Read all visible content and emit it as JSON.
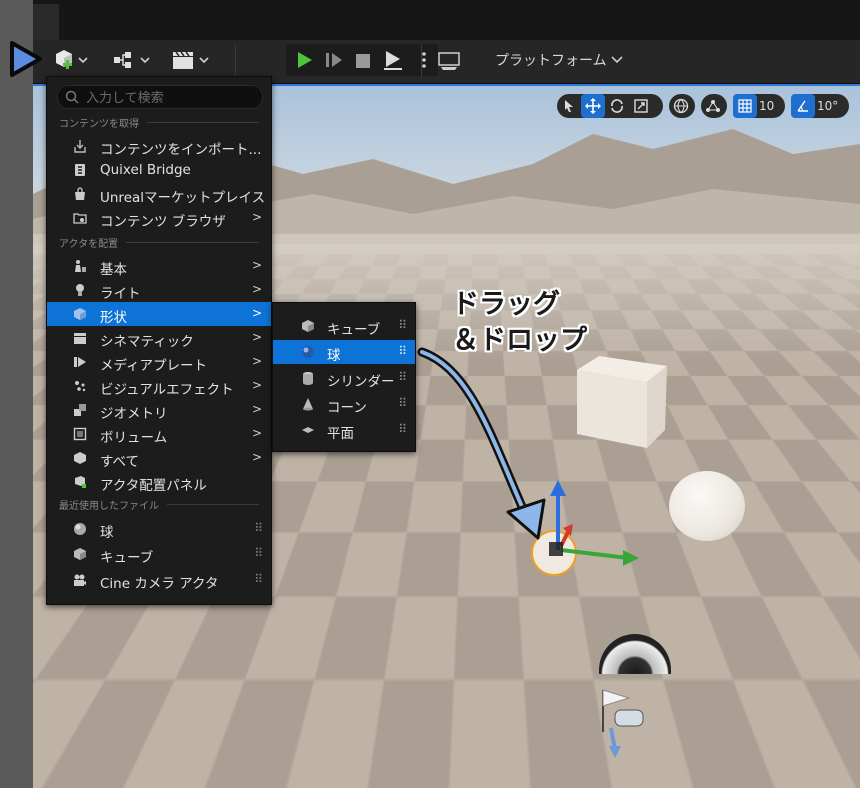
{
  "toolbar": {
    "platform_label": "プラットフォーム"
  },
  "viewport_toolbar": {
    "grid_snap": "10",
    "rotate_snap": "10°"
  },
  "menu": {
    "search_placeholder": "入力して検索",
    "sections": {
      "get_content": "コンテンツを取得",
      "place_actors": "アクタを配置",
      "recent": "最近使用したファイル"
    },
    "get_content_items": [
      {
        "label": "コンテンツをインポート...",
        "icon": "import-icon"
      },
      {
        "label": "Quixel Bridge",
        "icon": "bridge-icon"
      },
      {
        "label": "Unrealマーケットプレイス",
        "icon": "marketplace-icon"
      },
      {
        "label": "コンテンツ ブラウザ",
        "icon": "content-browser-icon"
      }
    ],
    "place_items": [
      {
        "label": "基本",
        "icon": "basic-icon"
      },
      {
        "label": "ライト",
        "icon": "light-icon"
      },
      {
        "label": "形状",
        "icon": "shape-icon",
        "selected": true
      },
      {
        "label": "シネマティック",
        "icon": "cinematic-icon"
      },
      {
        "label": "メディアプレート",
        "icon": "media-icon"
      },
      {
        "label": "ビジュアルエフェクト",
        "icon": "vfx-icon"
      },
      {
        "label": "ジオメトリ",
        "icon": "geometry-icon"
      },
      {
        "label": "ボリューム",
        "icon": "volume-icon"
      },
      {
        "label": "すべて",
        "icon": "all-icon"
      },
      {
        "label": "アクタ配置パネル",
        "icon": "place-panel-icon"
      }
    ],
    "recent_items": [
      {
        "label": "球",
        "icon": "sphere-icon"
      },
      {
        "label": "キューブ",
        "icon": "cube-icon"
      },
      {
        "label": "Cine カメラ アクタ",
        "icon": "camera-icon"
      }
    ]
  },
  "submenu": {
    "items": [
      {
        "label": "キューブ",
        "icon": "cube-icon"
      },
      {
        "label": "球",
        "icon": "sphere-icon",
        "selected": true
      },
      {
        "label": "シリンダー",
        "icon": "cylinder-icon"
      },
      {
        "label": "コーン",
        "icon": "cone-icon"
      },
      {
        "label": "平面",
        "icon": "plane-icon"
      }
    ]
  },
  "annotation": {
    "line1": "ドラッグ",
    "line2": "＆ドロップ"
  },
  "colors": {
    "accent": "#0e73d6",
    "play_green": "#4fc43a",
    "menu_bg": "#1c1c1c"
  }
}
